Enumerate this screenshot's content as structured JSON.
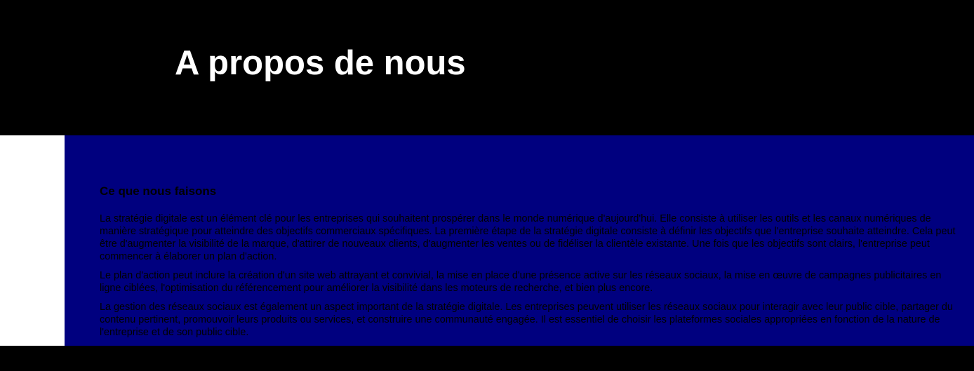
{
  "header": {
    "title": "A propos de nous"
  },
  "about": {
    "section_title": "Ce que nous faisons",
    "paragraphs": [
      "La stratégie digitale est un élément clé pour les entreprises qui souhaitent prospérer dans le monde numérique d'aujourd'hui. Elle consiste à utiliser les outils et les canaux numériques de manière stratégique pour atteindre des objectifs commerciaux spécifiques. La première étape de la stratégie digitale consiste à définir les objectifs que l'entreprise souhaite atteindre. Cela peut être d'augmenter la visibilité de la marque, d'attirer de nouveaux clients, d'augmenter les ventes ou de fidéliser la clientèle existante. Une fois que les objectifs sont clairs, l'entreprise peut commencer à élaborer un plan d'action.",
      "Le plan d'action peut inclure la création d'un site web attrayant et convivial, la mise en place d'une présence active sur les réseaux sociaux, la mise en œuvre de campagnes publicitaires en ligne ciblées, l'optimisation du référencement pour améliorer la visibilité dans les moteurs de recherche, et bien plus encore.",
      "La gestion des réseaux sociaux est également un aspect important de la stratégie digitale. Les entreprises peuvent utiliser les réseaux sociaux pour interagir avec leur public cible, partager du contenu pertinent, promouvoir leurs produits ou services, et construire une communauté engagée. Il est essentiel de choisir les plateformes sociales appropriées en fonction de la nature de l'entreprise et de son public cible."
    ]
  },
  "colors": {
    "header_background": "#000000",
    "panel_background": "#00007f",
    "side_strip": "#ffffff",
    "title_text": "#ffffff",
    "body_text": "#000000"
  }
}
